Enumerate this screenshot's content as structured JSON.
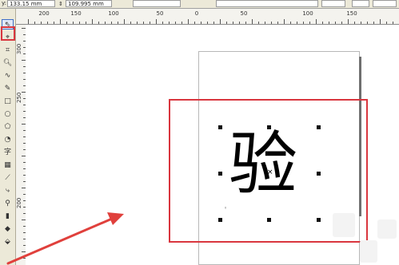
{
  "property_bar": {
    "y_label": "y:",
    "y_value": "133.15 mm",
    "height_value": "109.995 mm"
  },
  "horizontal_ruler": {
    "labels": [
      "200",
      "150",
      "100",
      "50",
      "0",
      "50",
      "100",
      "150"
    ]
  },
  "vertical_ruler": {
    "labels": [
      "300",
      "250",
      "200"
    ]
  },
  "toolbox": {
    "tools": [
      "pick-tool",
      "shape-tool",
      "crop-tool",
      "zoom-tool",
      "freehand-tool",
      "smart-fill-tool",
      "rectangle-tool",
      "ellipse-tool",
      "polygon-tool",
      "basic-shapes-tool",
      "text-tool",
      "table-tool",
      "dimension-tool",
      "connector-tool",
      "dropper-tool",
      "outline-tool",
      "fill-tool",
      "interactive-fill-tool"
    ]
  },
  "canvas": {
    "glyph_text": "验"
  },
  "annotation": {
    "highlight_color": "#d9363e"
  }
}
